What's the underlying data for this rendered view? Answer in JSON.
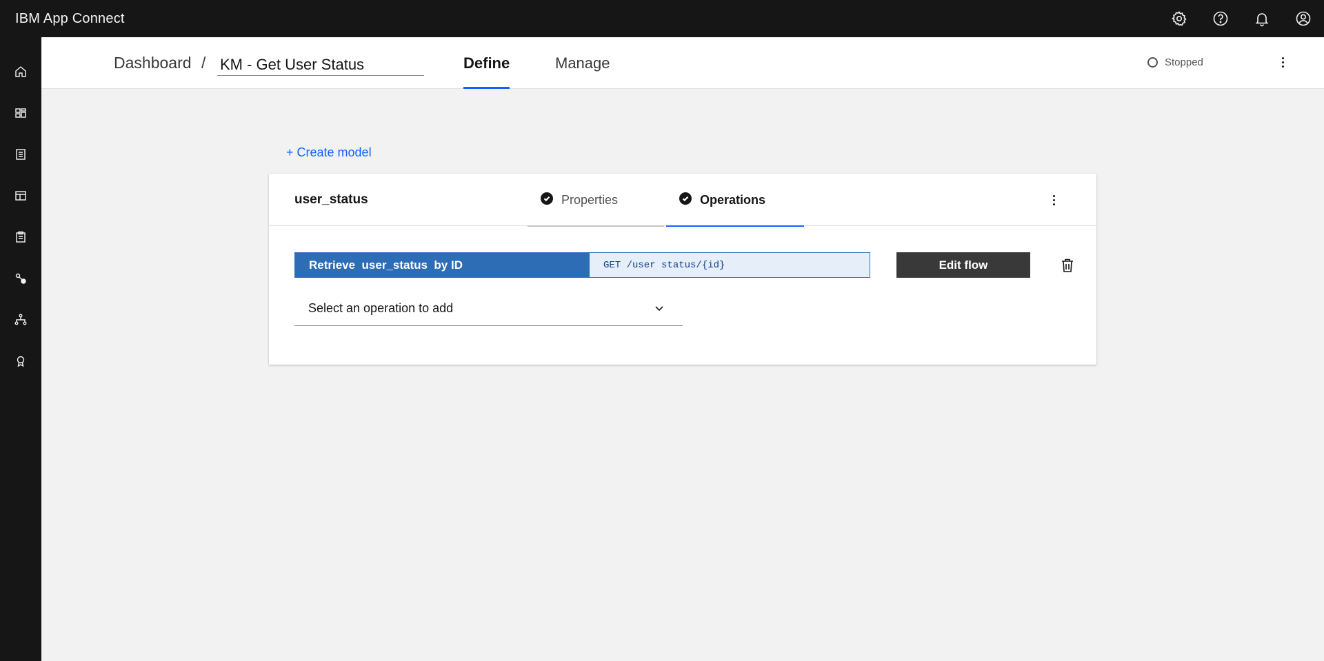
{
  "app": {
    "title": "IBM App Connect"
  },
  "header_icons": [
    "gear-icon",
    "help-icon",
    "notification-bell-icon",
    "user-avatar-icon"
  ],
  "siderail": {
    "items": [
      "home-icon",
      "dashboard-icon",
      "catalog-icon",
      "templates-icon",
      "clipboard-icon",
      "connections-icon",
      "flows-icon",
      "badge-icon"
    ]
  },
  "subheader": {
    "breadcrumb_root": "Dashboard",
    "breadcrumb_separator": "/",
    "api_name": "KM - Get User Status",
    "tabs": [
      {
        "label": "Define",
        "active": true
      },
      {
        "label": "Manage",
        "active": false
      }
    ],
    "status": "Stopped"
  },
  "create_model_label": "+ Create model",
  "model_card": {
    "model_name": "user_status",
    "tabs": [
      {
        "label": "Properties",
        "complete": true,
        "active": false
      },
      {
        "label": "Operations",
        "complete": true,
        "active": true
      }
    ],
    "operation": {
      "label": "Retrieve  user_status  by ID",
      "path": "GET /user status/{id}"
    },
    "edit_flow_label": "Edit flow",
    "select_placeholder": "Select an operation to add"
  },
  "colors": {
    "header_bg": "#161616",
    "accent_blue": "#0f62fe",
    "operation_blue": "#2d6db5",
    "page_bg": "#f2f2f2"
  }
}
